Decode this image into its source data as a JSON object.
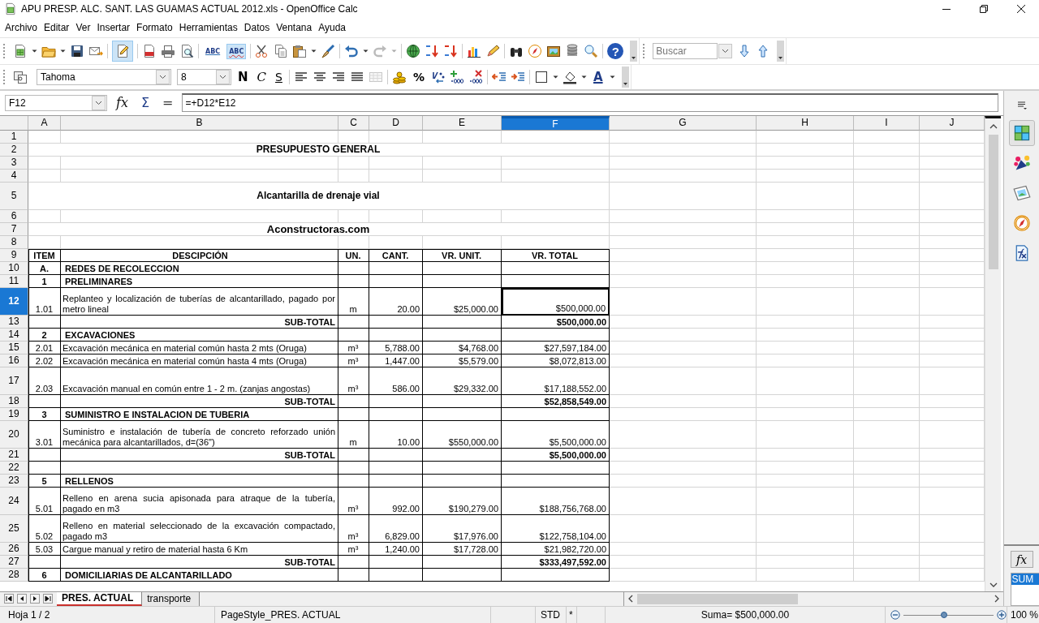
{
  "window": {
    "title": "APU PRESP. ALC. SANT. LAS GUAMAS ACTUAL 2012.xls - OpenOffice Calc"
  },
  "menu": [
    "Archivo",
    "Editar",
    "Ver",
    "Insertar",
    "Formato",
    "Herramientas",
    "Datos",
    "Ventana",
    "Ayuda"
  ],
  "standard_toolbar": {
    "edit_mode": {
      "on": true
    },
    "spellcheck": {
      "label": "ABC"
    },
    "autospell": {
      "label": "ABC",
      "on": true
    },
    "help_label": "?",
    "search": {
      "placeholder": "Buscar"
    }
  },
  "formatting_toolbar": {
    "font": "Tahoma",
    "size": "8",
    "style_buttons": [
      "N",
      "C",
      "S"
    ],
    "percent": "%",
    "font_color_label": "A"
  },
  "formula_bar": {
    "cell": "F12",
    "buttons": [
      "fx",
      "Σ",
      "="
    ],
    "formula": "=+D12*E12"
  },
  "columns": [
    {
      "label": "A",
      "selected": false
    },
    {
      "label": "B",
      "selected": false
    },
    {
      "label": "C",
      "selected": false
    },
    {
      "label": "D",
      "selected": false
    },
    {
      "label": "E",
      "selected": false
    },
    {
      "label": "F",
      "selected": true
    },
    {
      "label": "G",
      "selected": false
    },
    {
      "label": "H",
      "selected": false
    },
    {
      "label": "I",
      "selected": false
    },
    {
      "label": "J",
      "selected": false
    }
  ],
  "rows": [
    {
      "number": "1",
      "kind": "blank",
      "selected": false
    },
    {
      "number": "2",
      "kind": "title",
      "selected": false,
      "text": "PRESUPUESTO GENERAL"
    },
    {
      "number": "3",
      "kind": "blank",
      "selected": false
    },
    {
      "number": "4",
      "kind": "blank",
      "selected": false
    },
    {
      "number": "5",
      "kind": "title",
      "selected": false,
      "text": "Alcantarilla de drenaje vial"
    },
    {
      "number": "6",
      "kind": "blank",
      "selected": false
    },
    {
      "number": "7",
      "kind": "site-title",
      "selected": false,
      "text": "Aconstructoras.com"
    },
    {
      "number": "8",
      "kind": "blank",
      "selected": false
    },
    {
      "number": "9",
      "kind": "header",
      "selected": false,
      "cells": {
        "item": "ITEM",
        "description": "DESCIPCIÓN",
        "unit": "UN.",
        "quantity": "CANT.",
        "unit_price": "VR. UNIT.",
        "total": "VR. TOTAL"
      }
    },
    {
      "number": "10",
      "kind": "section",
      "selected": false,
      "cells": {
        "item": "A.",
        "description": "REDES DE RECOLECCION"
      }
    },
    {
      "number": "11",
      "kind": "section",
      "selected": false,
      "cells": {
        "item": "1",
        "description": "PRELIMINARES"
      }
    },
    {
      "number": "12",
      "kind": "item",
      "selected": true,
      "cells": {
        "item": "1.01",
        "description": "Replanteo y localización de tuberías de alcantarillado, pagado por metro lineal",
        "unit": "m",
        "quantity": "20.00",
        "unit_price": "$25,000.00",
        "total": "$500,000.00"
      }
    },
    {
      "number": "13",
      "kind": "subtotal",
      "selected": false,
      "cells": {
        "description": "SUB-TOTAL",
        "total": "$500,000.00"
      }
    },
    {
      "number": "14",
      "kind": "section",
      "selected": false,
      "cells": {
        "item": "2",
        "description": "EXCAVACIONES"
      }
    },
    {
      "number": "15",
      "kind": "item",
      "selected": false,
      "cells": {
        "item": "2.01",
        "description": "Excavación mecánica en material común hasta 2 mts (Oruga)",
        "unit": "m³",
        "quantity": "5,788.00",
        "unit_price": "$4,768.00",
        "total": "$27,597,184.00"
      }
    },
    {
      "number": "16",
      "kind": "item",
      "selected": false,
      "cells": {
        "item": "2.02",
        "description": "Excavación mecánica en material común hasta 4 mts (Oruga)",
        "unit": "m³",
        "quantity": "1,447.00",
        "unit_price": "$5,579.00",
        "total": "$8,072,813.00"
      }
    },
    {
      "number": "17",
      "kind": "item",
      "selected": false,
      "cells": {
        "item": "2.03",
        "description": "Excavación manual en común entre 1  - 2 m. (zanjas angostas)",
        "unit": "m³",
        "quantity": "586.00",
        "unit_price": "$29,332.00",
        "total": "$17,188,552.00"
      }
    },
    {
      "number": "18",
      "kind": "subtotal",
      "selected": false,
      "cells": {
        "description": "SUB-TOTAL",
        "total": "$52,858,549.00"
      }
    },
    {
      "number": "19",
      "kind": "section",
      "selected": false,
      "cells": {
        "item": "3",
        "description": "SUMINISTRO E INSTALACION DE TUBERIA"
      }
    },
    {
      "number": "20",
      "kind": "item",
      "selected": false,
      "cells": {
        "item": "3.01",
        "description": "Suministro e instalación de tubería de concreto reforzado unión mecánica para alcantarillados, d=(36\")",
        "unit": "m",
        "quantity": "10.00",
        "unit_price": "$550,000.00",
        "total": "$5,500,000.00"
      }
    },
    {
      "number": "21",
      "kind": "subtotal",
      "selected": false,
      "cells": {
        "description": "SUB-TOTAL",
        "total": "$5,500,000.00"
      }
    },
    {
      "number": "22",
      "kind": "empty",
      "selected": false
    },
    {
      "number": "23",
      "kind": "section",
      "selected": false,
      "cells": {
        "item": "5",
        "description": "RELLENOS"
      }
    },
    {
      "number": "24",
      "kind": "item",
      "selected": false,
      "cells": {
        "item": "5.01",
        "description": "Relleno en arena sucia apisonada para atraque de la tubería, pagado en m3",
        "unit": "m³",
        "quantity": "992.00",
        "unit_price": "$190,279.00",
        "total": "$188,756,768.00"
      }
    },
    {
      "number": "25",
      "kind": "item",
      "selected": false,
      "cells": {
        "item": "5.02",
        "description": "Relleno en material seleccionado de la excavación compactado, pagado  m3",
        "unit": "m³",
        "quantity": "6,829.00",
        "unit_price": "$17,976.00",
        "total": "$122,758,104.00"
      }
    },
    {
      "number": "26",
      "kind": "item",
      "selected": false,
      "cells": {
        "item": "5.03",
        "description": "Cargue manual y retiro de material hasta 6 Km",
        "unit": "m³",
        "quantity": "1,240.00",
        "unit_price": "$17,728.00",
        "total": "$21,982,720.00"
      }
    },
    {
      "number": "27",
      "kind": "subtotal",
      "selected": false,
      "cells": {
        "description": "SUB-TOTAL",
        "total": "$333,497,592.00"
      }
    },
    {
      "number": "28",
      "kind": "section",
      "selected": false,
      "cells": {
        "item": "6",
        "description": "DOMICILIARIAS DE ALCANTARILLADO"
      }
    }
  ],
  "sheet_tabs": [
    {
      "label": "PRES. ACTUAL",
      "selected": true
    },
    {
      "label": "transporte",
      "selected": false
    }
  ],
  "sidebar": {
    "function_button": "fx",
    "functions": [
      {
        "label": "SUM",
        "selected": true
      }
    ]
  },
  "status_bar": {
    "sheet": "Hoja 1 / 2",
    "page_style": "PageStyle_PRES. ACTUAL",
    "mode": "STD",
    "modified": "*",
    "sum": "Suma= $500,000.00",
    "zoom": {
      "level": 0.45
    },
    "zoom_label": "100 %"
  }
}
